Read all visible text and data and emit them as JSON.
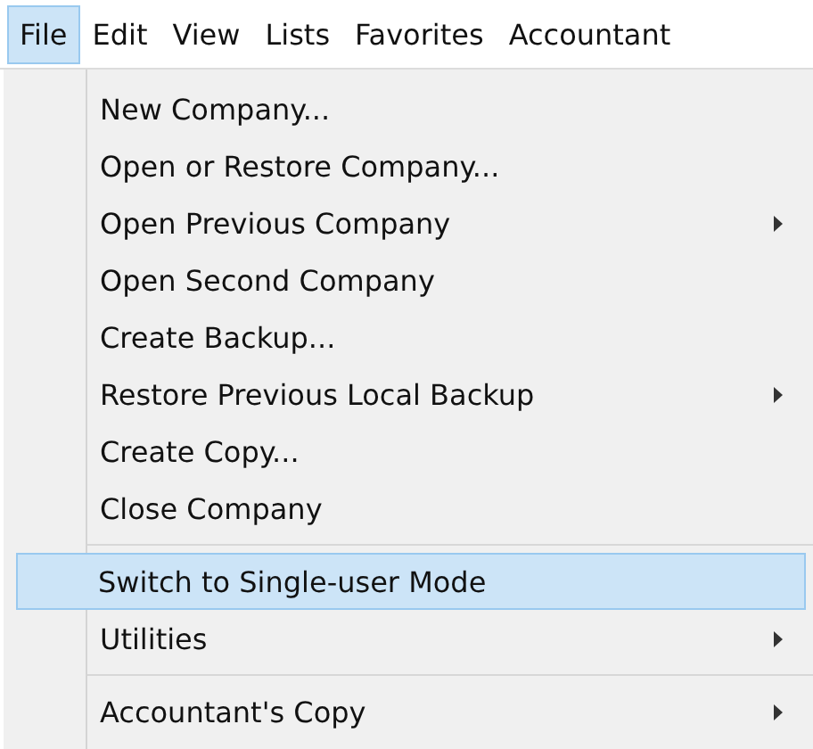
{
  "menubar": [
    {
      "label": "File",
      "selected": true
    },
    {
      "label": "Edit",
      "selected": false
    },
    {
      "label": "View",
      "selected": false
    },
    {
      "label": "Lists",
      "selected": false
    },
    {
      "label": "Favorites",
      "selected": false
    },
    {
      "label": "Accountant",
      "selected": false
    }
  ],
  "menu": [
    {
      "kind": "item",
      "label": "New Company...",
      "submenu": false,
      "selected": false
    },
    {
      "kind": "item",
      "label": "Open or Restore Company...",
      "submenu": false,
      "selected": false
    },
    {
      "kind": "item",
      "label": "Open Previous Company",
      "submenu": true,
      "selected": false
    },
    {
      "kind": "item",
      "label": "Open Second Company",
      "submenu": false,
      "selected": false
    },
    {
      "kind": "item",
      "label": "Create Backup...",
      "submenu": false,
      "selected": false
    },
    {
      "kind": "item",
      "label": "Restore Previous Local Backup",
      "submenu": true,
      "selected": false
    },
    {
      "kind": "item",
      "label": "Create Copy...",
      "submenu": false,
      "selected": false
    },
    {
      "kind": "item",
      "label": "Close Company",
      "submenu": false,
      "selected": false
    },
    {
      "kind": "separator"
    },
    {
      "kind": "item",
      "label": "Switch to Single-user Mode",
      "submenu": false,
      "selected": true
    },
    {
      "kind": "item",
      "label": "Utilities",
      "submenu": true,
      "selected": false
    },
    {
      "kind": "separator"
    },
    {
      "kind": "item",
      "label": "Accountant's Copy",
      "submenu": true,
      "selected": false
    }
  ]
}
